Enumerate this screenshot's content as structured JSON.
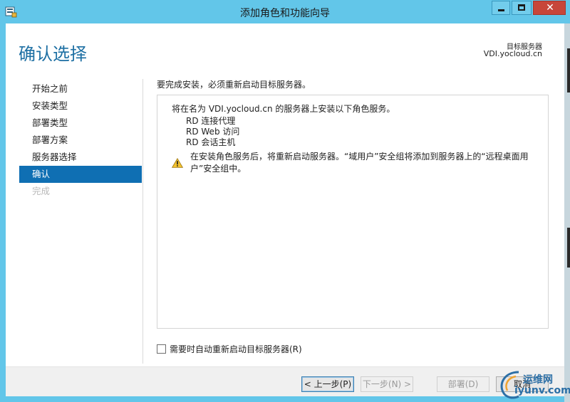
{
  "window": {
    "title": "添加角色和功能向导"
  },
  "header": {
    "page_title": "确认选择",
    "destination_label": "目标服务器",
    "destination_server": "VDI.yocloud.cn"
  },
  "nav": {
    "items": [
      {
        "label": "开始之前",
        "state": "normal"
      },
      {
        "label": "安装类型",
        "state": "normal"
      },
      {
        "label": "部署类型",
        "state": "normal"
      },
      {
        "label": "部署方案",
        "state": "normal"
      },
      {
        "label": "服务器选择",
        "state": "normal"
      },
      {
        "label": "确认",
        "state": "active"
      },
      {
        "label": "完成",
        "state": "disabled"
      }
    ]
  },
  "content": {
    "intro": "要完成安装，必须重新启动目标服务器。",
    "summary_heading": "将在名为 VDI.yocloud.cn 的服务器上安装以下角色服务。",
    "services": [
      "RD 连接代理",
      "RD Web 访问",
      "RD 会话主机"
    ],
    "warning_text": "在安装角色服务后，将重新启动服务器。“域用户”安全组将添加到服务器上的“远程桌面用户”安全组中。",
    "restart_checkbox_label": "需要时自动重新启动目标服务器(R)",
    "restart_checked": false
  },
  "footer": {
    "prev": "< 上一步(P)",
    "next": "下一步(N) >",
    "deploy": "部署(D)",
    "cancel": "取消"
  },
  "watermark": {
    "line1": "运维网",
    "line2": "iyunv.com"
  },
  "colors": {
    "titlebar": "#62c6e9",
    "accent": "#0f6fb3",
    "title_blue": "#1d6fa3",
    "close_red": "#c7463a"
  }
}
